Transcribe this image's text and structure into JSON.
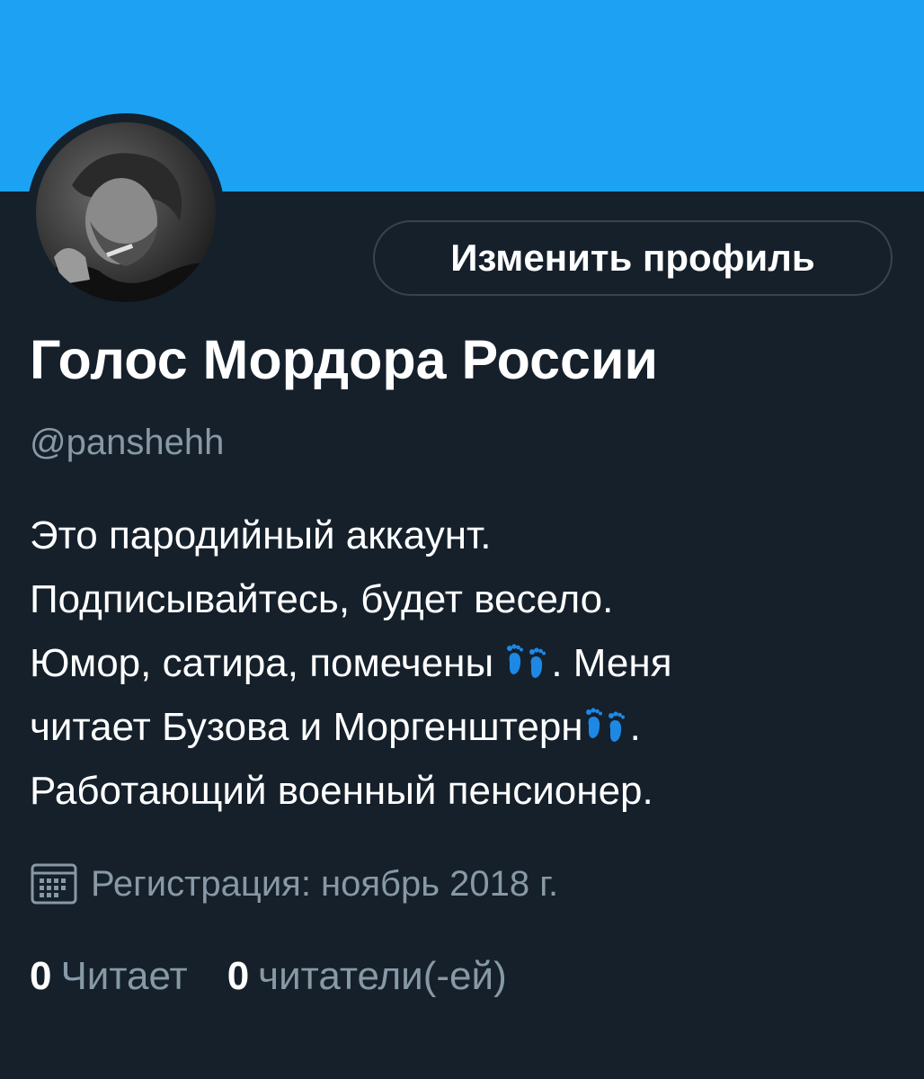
{
  "colors": {
    "banner": "#1da1f2",
    "background": "#15202b",
    "primary_text": "#ffffff",
    "secondary_text": "#8899a6",
    "border": "#38444d",
    "emoji_blue": "#1e88e5"
  },
  "profile": {
    "edit_button_label": "Изменить профиль",
    "display_name": "Голос Мордора России",
    "handle": "@panshehh",
    "bio": {
      "line1": "Это пародийный аккаунт.",
      "line2": "Подписывайтесь, будет весело.",
      "line3_a": "Юмор, сатира, помечены ",
      "line3_b": ". Меня",
      "line4_a": "читает Бузова и Моргенштерн",
      "line4_b": ".",
      "line5": "Работающий военный пенсионер.",
      "emoji": "footprints-emoji"
    },
    "joined_icon": "calendar-icon",
    "joined_text": "Регистрация: ноябрь 2018 г.",
    "following_count": "0",
    "following_label": "Читает",
    "followers_count": "0",
    "followers_label": "читатели(-ей)"
  }
}
